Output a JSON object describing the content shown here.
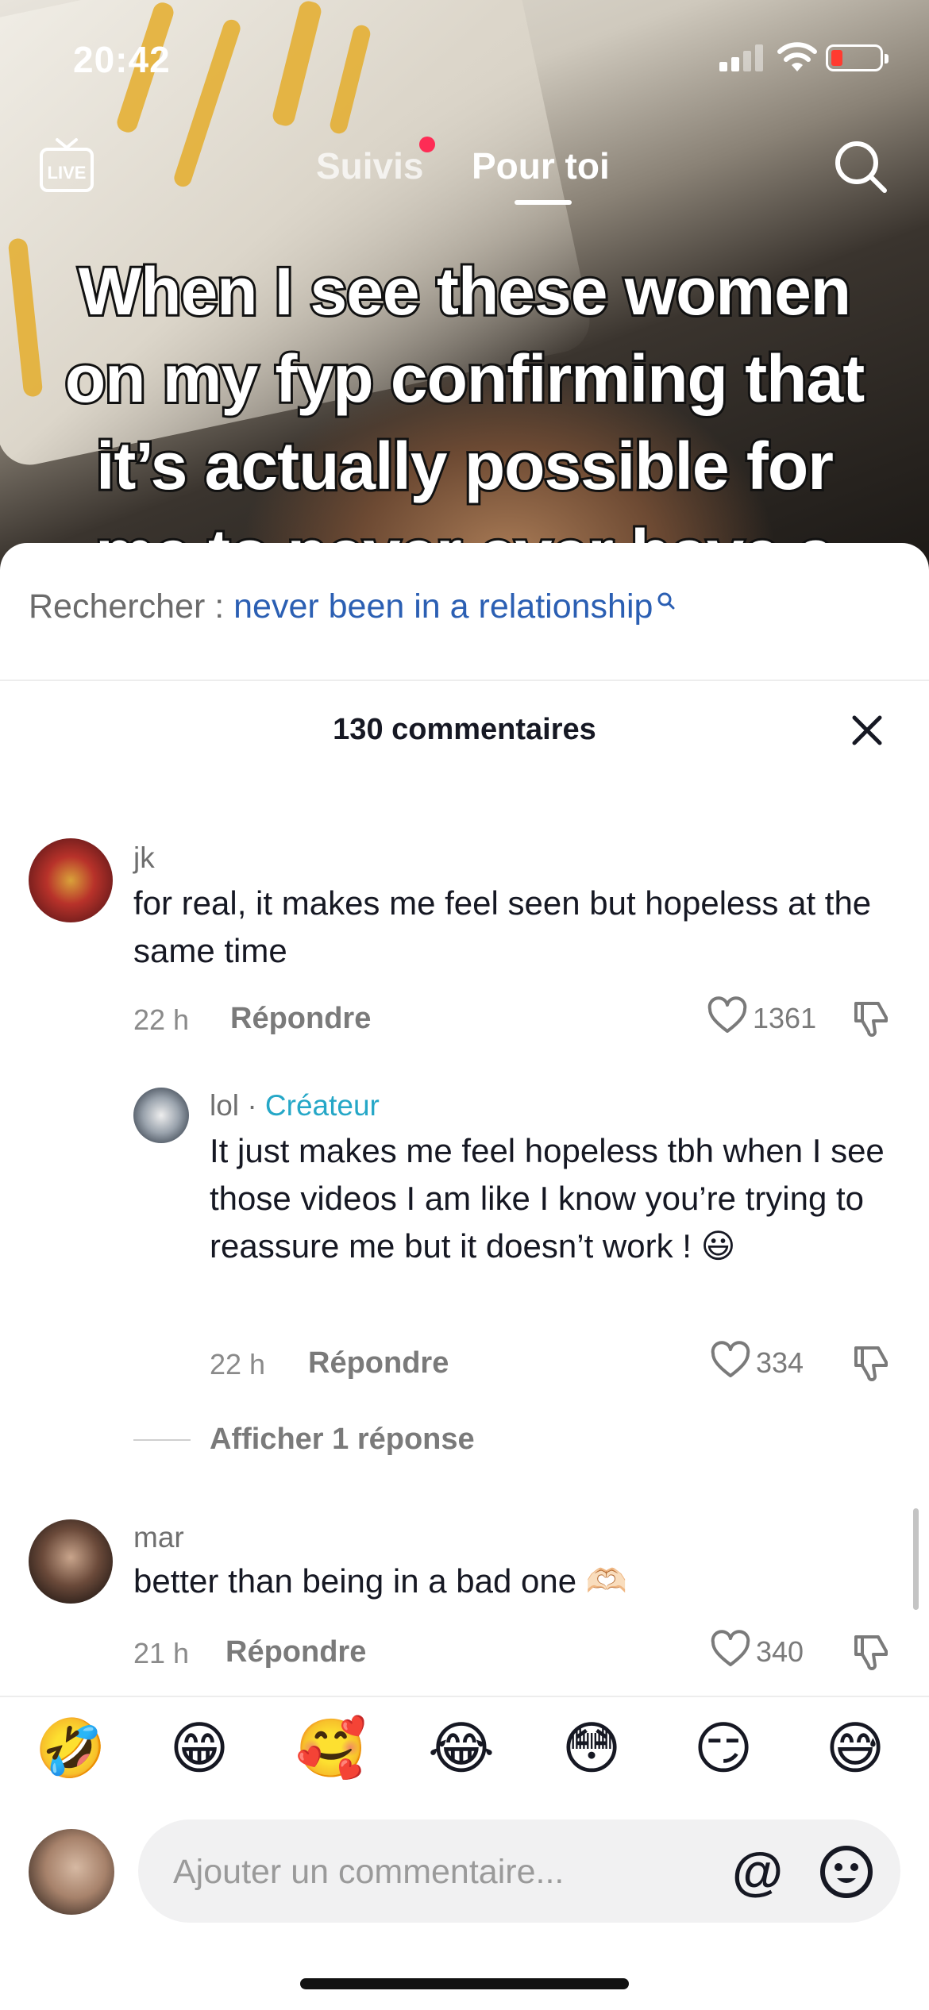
{
  "status_bar": {
    "time": "20:42"
  },
  "top_nav": {
    "live_label": "LIVE",
    "tabs": [
      {
        "label": "Suivis",
        "active": false,
        "has_dot": true
      },
      {
        "label": "Pour toi",
        "active": true
      }
    ],
    "search_icon": "search-icon"
  },
  "video": {
    "caption_lines": [
      "When I see these women",
      "on my fyp confirming that",
      "it’s actually possible for",
      "me to never ever have a"
    ]
  },
  "comments_sheet": {
    "search": {
      "prefix": "Rechercher :",
      "query": "never been in a relationship"
    },
    "title": "130 commentaires",
    "comments": [
      {
        "user": "jk",
        "text": "for real, it makes me feel seen but hopeless at the same time",
        "time": "22 h",
        "reply_label": "Répondre",
        "likes": "1361"
      },
      {
        "user": "lol",
        "badge_sep": "·",
        "badge": "Créateur",
        "text": "It just makes me feel hopeless tbh when I see those videos I am like I know you’re trying to reassure me but it doesn’t work ! 😃",
        "time": "22 h",
        "reply_label": "Répondre",
        "likes": "334"
      },
      {
        "user": "mar",
        "text": "better than being in a bad one 🫶🏻",
        "time": "21 h",
        "reply_label": "Répondre",
        "likes": "340"
      }
    ],
    "show_replies": "Afficher 1 réponse",
    "emoji_bar": [
      "🤣",
      "😁",
      "🥰",
      "😂",
      "😳",
      "😏",
      "😅"
    ],
    "input": {
      "placeholder": "Ajouter un commentaire...",
      "at_symbol": "@"
    }
  }
}
